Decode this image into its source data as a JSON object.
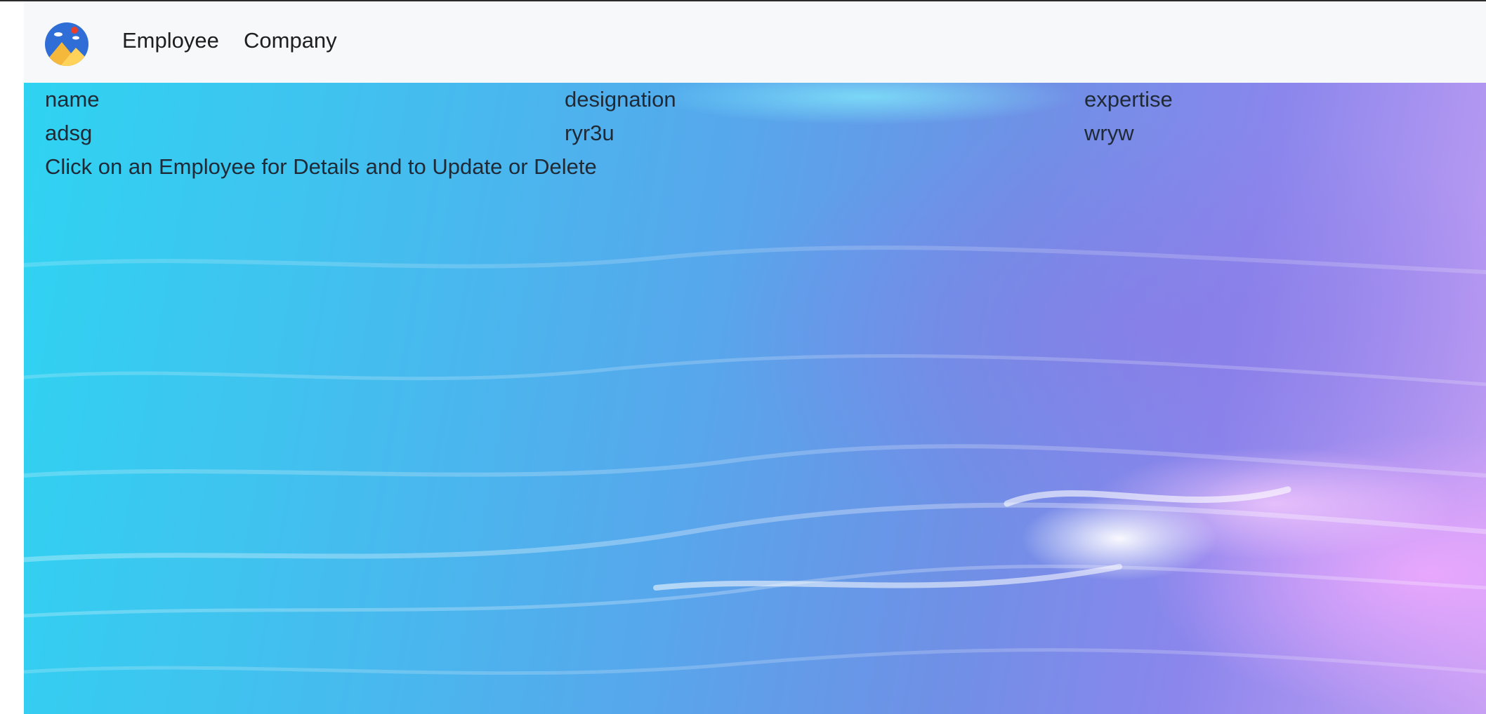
{
  "navbar": {
    "logo": {
      "icon": "landscape-logo-icon"
    },
    "links": [
      "Employee",
      "Company"
    ]
  },
  "employees": {
    "columns": [
      "name",
      "designation",
      "expertise"
    ],
    "rows": [
      [
        "adsg",
        "ryr3u",
        "wryw"
      ]
    ]
  },
  "hint": "Click on an Employee for Details and to Update or Delete",
  "colors": {
    "navbar_bg": "#f7f8fa",
    "text": "#1f2a36"
  }
}
